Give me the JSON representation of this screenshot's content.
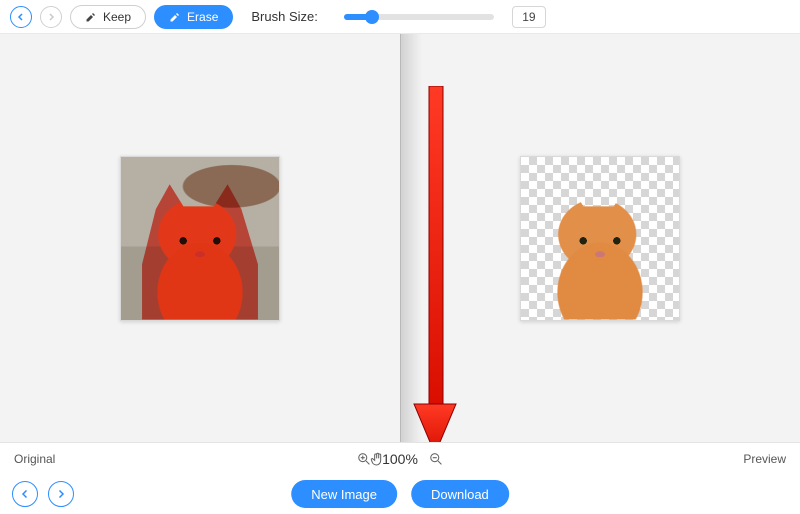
{
  "toolbar": {
    "keep_label": "Keep",
    "erase_label": "Erase",
    "brush_label": "Brush Size:",
    "brush_value": "19"
  },
  "status": {
    "original_label": "Original",
    "zoom_label": "100%",
    "preview_label": "Preview"
  },
  "actions": {
    "new_image_label": "New Image",
    "download_label": "Download"
  },
  "colors": {
    "accent": "#2c8eff",
    "mask": "#ff2a14"
  }
}
